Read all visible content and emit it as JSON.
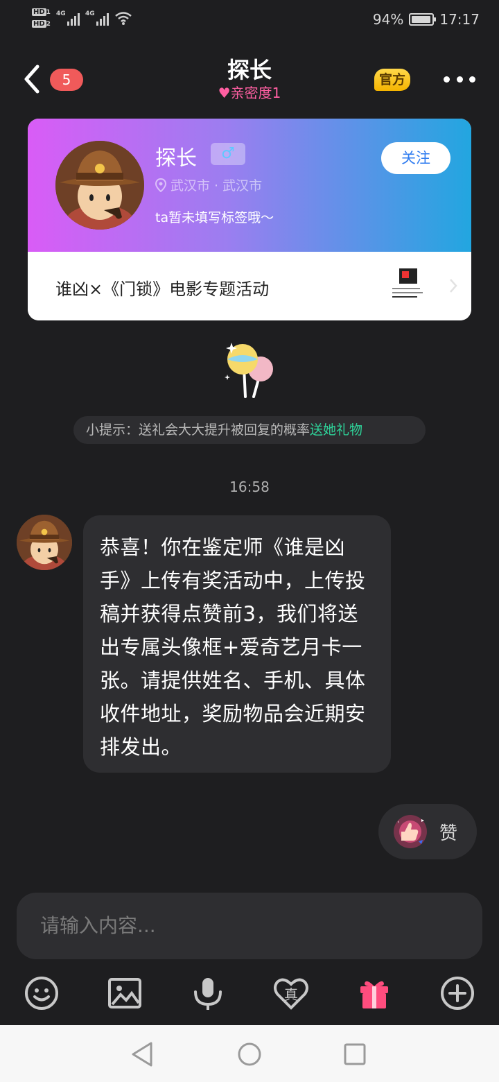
{
  "status_bar": {
    "hd1": "HD",
    "hd2": "HD",
    "sim1_sub": "1",
    "sim2_sub": "2",
    "net1": "4G",
    "net2": "4G",
    "battery": "94%",
    "battery_level": 0.94,
    "time": "17:17"
  },
  "header": {
    "unread_count": "5",
    "title": "探长",
    "intimacy_label": "亲密度",
    "intimacy_value": "1",
    "official_badge": "官方"
  },
  "profile": {
    "name": "探长",
    "gender_symbol": "♂",
    "location": "武汉市 · 武汉市",
    "signature": "ta暂未填写标签哦～",
    "follow_label": "关注",
    "activity_title": "谁凶×《门锁》电影专题活动"
  },
  "tip": {
    "text": "小提示：送礼会大大提升被回复的概率",
    "action": "送她礼物"
  },
  "chat": {
    "timestamp": "16:58",
    "message": "恭喜！你在鉴定师《谁是凶手》上传有奖活动中，上传投稿并获得点赞前3，我们将送出专属头像框+爱奇艺月卡一张。请提供姓名、手机、具体收件地址，奖励物品会近期安排发出。"
  },
  "like_button": {
    "label": "赞"
  },
  "input": {
    "placeholder": "请输入内容..."
  },
  "toolbar": {
    "items": [
      "emoji-icon",
      "image-icon",
      "microphone-icon",
      "truth-heart-icon",
      "gift-icon",
      "plus-icon"
    ],
    "truth_glyph": "真",
    "gift_color": "#ff4d7e"
  },
  "colors": {
    "intimacy": "#ff5fa2",
    "tip_action": "#2ed49a",
    "unread_badge": "#f05a5a"
  }
}
